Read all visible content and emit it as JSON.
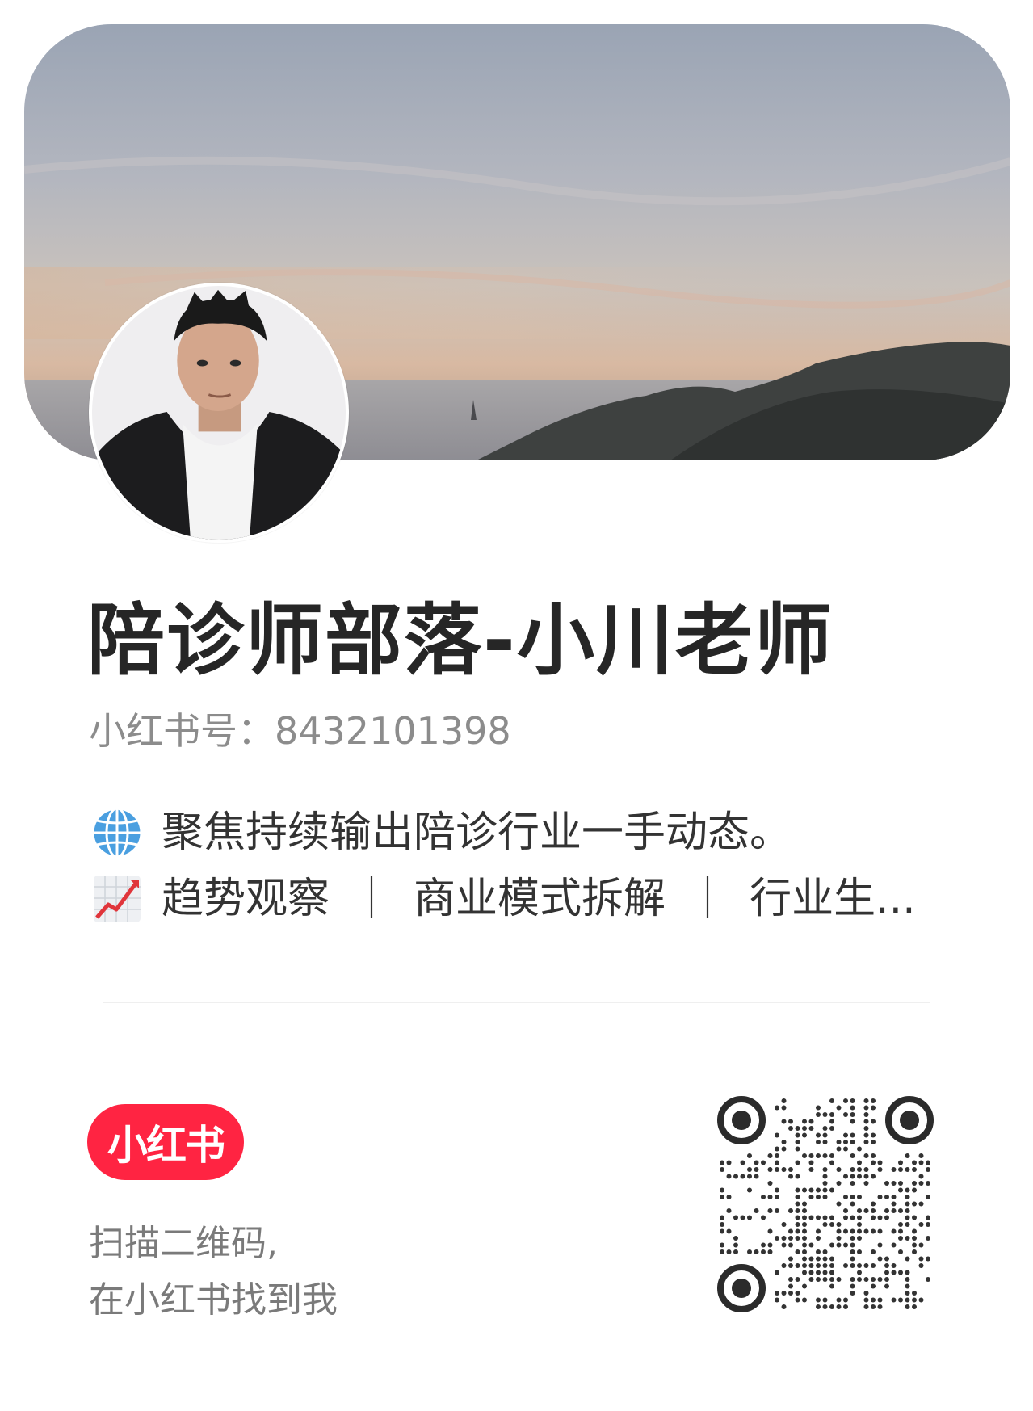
{
  "profile": {
    "name": "陪诊师部落-小川老师",
    "id_label": "小红书号：",
    "id_value": "8432101398"
  },
  "bio": {
    "line1_icon": "globe-icon",
    "line1_text": "聚焦持续输出陪诊行业一手动态。",
    "line2_icon": "chart-increasing-icon",
    "line2_items": [
      "趋势观察",
      "商业模式拆解",
      "行业生"
    ],
    "line2_separator": "｜",
    "line2_ellipsis": "..."
  },
  "footer": {
    "brand_badge": "小红书",
    "scan_line1": "扫描二维码,",
    "scan_line2": "在小红书找到我"
  },
  "colors": {
    "brand": "#ff2442",
    "name_text": "#262626",
    "muted_text": "#8c8c8c"
  }
}
